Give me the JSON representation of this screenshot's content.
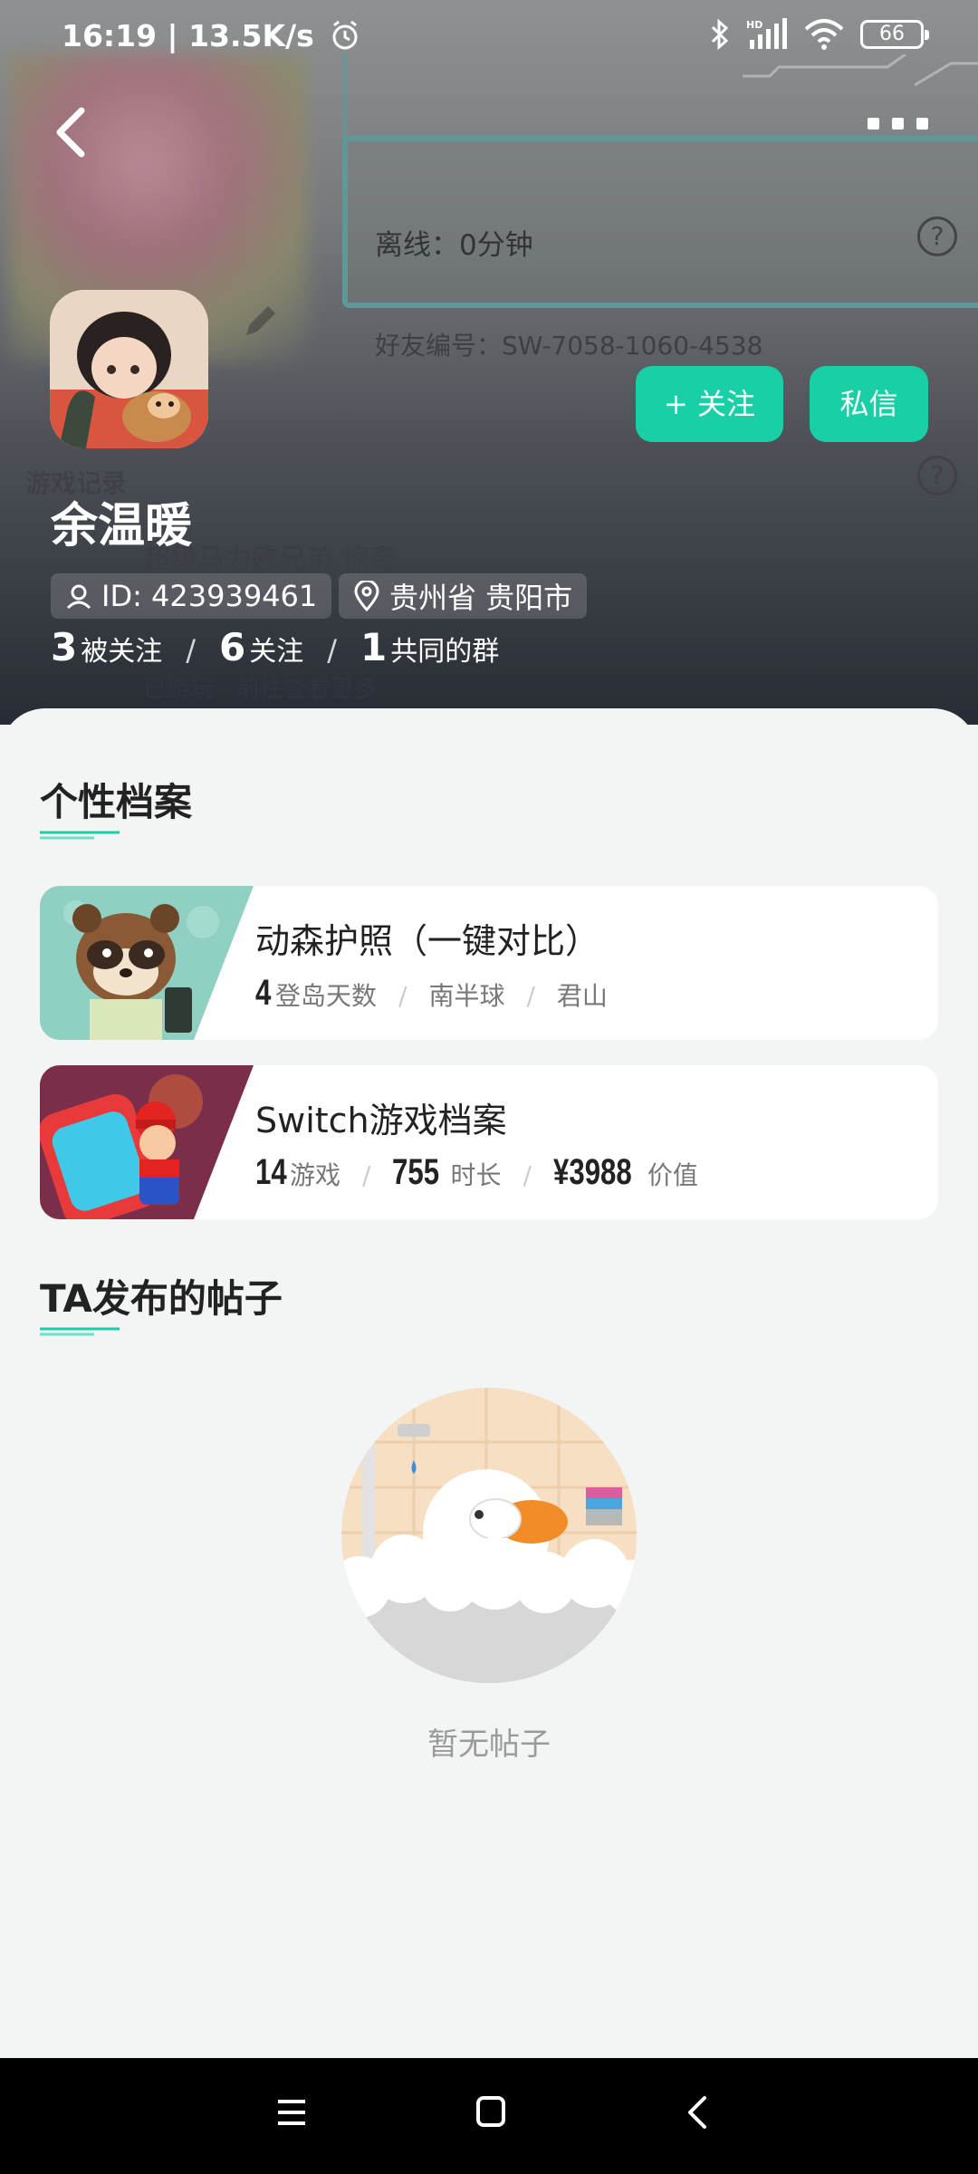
{
  "status_bar": {
    "time_speed": "16:19 | 13.5K/s",
    "battery": "66",
    "icons": [
      "alarm-icon",
      "bluetooth-icon",
      "hd-signal-icon",
      "wifi-icon",
      "battery-icon"
    ]
  },
  "background": {
    "offline_label": "离线：0分钟",
    "friend_code": "好友编号：SW-7058-1060-4538",
    "game_record": "游戏记录",
    "game_name": "超级马力欧兄弟 惊奇",
    "game_extra": "已游玩 · 前往查看更多"
  },
  "profile": {
    "name": "余温暖",
    "id_label": "ID: 423939461",
    "location": "贵州省 贵阳市",
    "follow_button": "+ 关注",
    "message_button": "私信",
    "stats": [
      {
        "num": "3",
        "label": "被关注"
      },
      {
        "num": "6",
        "label": "关注"
      },
      {
        "num": "1",
        "label": "共同的群"
      }
    ],
    "stat_sep": "/"
  },
  "profile_section": {
    "title": "个性档案",
    "cards": [
      {
        "title": "动森护照（一键对比）",
        "items": [
          {
            "num": "4",
            "label": "登岛天数"
          },
          {
            "value": "南半球"
          },
          {
            "value": "君山"
          }
        ]
      },
      {
        "title": "Switch游戏档案",
        "items": [
          {
            "num": "14",
            "label": "游戏"
          },
          {
            "num": "755",
            "label": "时长"
          },
          {
            "num": "¥3988",
            "label": "价值"
          }
        ]
      }
    ]
  },
  "posts_section": {
    "title": "TA发布的帖子",
    "empty_text": "暂无帖子"
  },
  "colors": {
    "accent": "#19cfa6",
    "header_dark": "#272b33",
    "sheet_bg": "#f3f5f5"
  }
}
